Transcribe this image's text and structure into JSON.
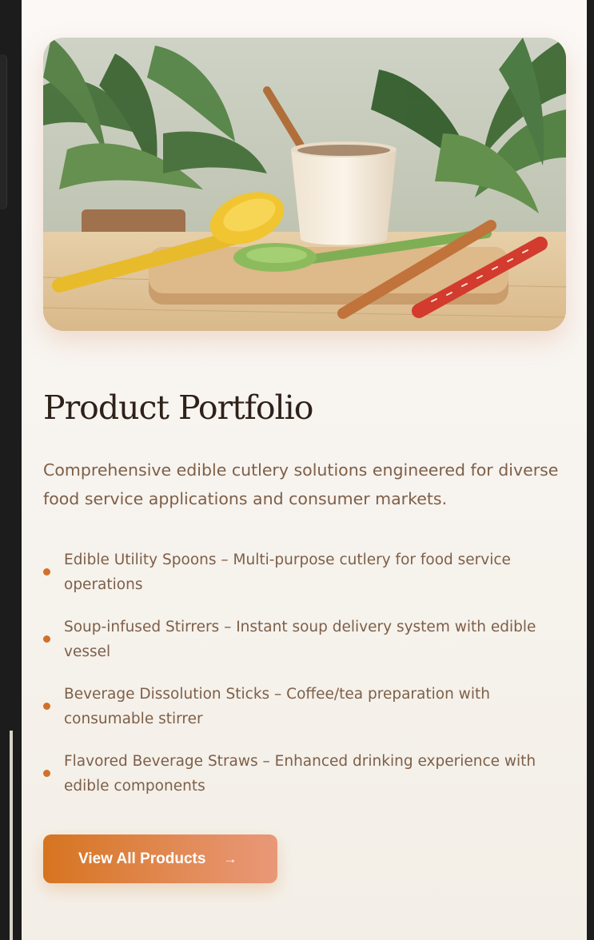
{
  "page": {
    "accent_color": "#d1702a",
    "title_color": "#2e2119",
    "text_color": "#7d5f48"
  },
  "hero_image": {
    "alt": "Edible spoons, stirrers and straws on a wooden board with a cup and plants"
  },
  "section": {
    "title": "Product Portfolio",
    "description": "Comprehensive edible cutlery solutions engineered for diverse food service applications and consumer markets.",
    "features": [
      {
        "text": "Edible Utility Spoons – Multi-purpose cutlery for food service operations"
      },
      {
        "text": "Soup-infused Stirrers – Instant soup delivery system with edible vessel"
      },
      {
        "text": "Beverage Dissolution Sticks – Coffee/tea preparation with consumable stirrer"
      },
      {
        "text": "Flavored Beverage Straws – Enhanced drinking experience with edible components"
      }
    ],
    "cta": {
      "label": "View All Products",
      "icon": "arrow-right-icon",
      "gradient": [
        "#d6741f",
        "#e99878"
      ]
    }
  }
}
